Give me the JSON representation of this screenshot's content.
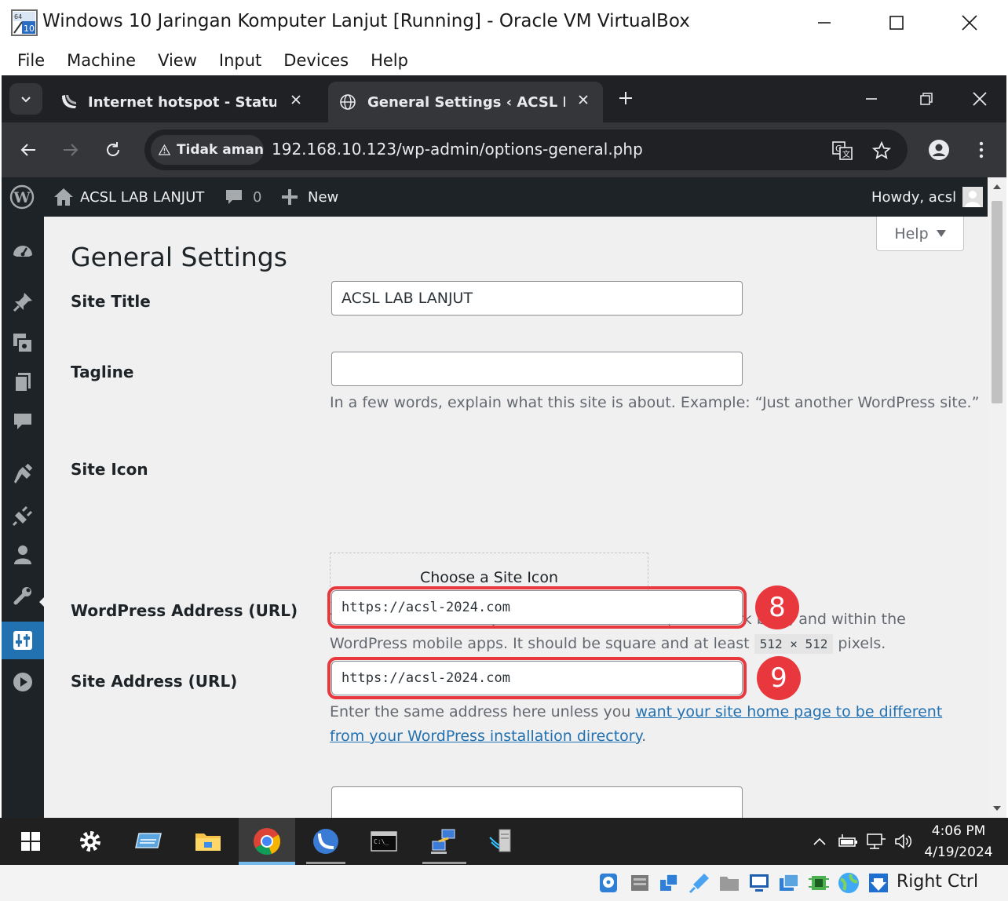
{
  "vbox": {
    "title": "Windows 10 Jaringan Komputer Lanjut [Running] - Oracle VM VirtualBox",
    "menu": [
      "File",
      "Machine",
      "View",
      "Input",
      "Devices",
      "Help"
    ],
    "host_key": "Right Ctrl"
  },
  "browser": {
    "tabs": [
      {
        "label": "Internet hotspot - Status",
        "active": false
      },
      {
        "label": "General Settings ‹ ACSL LAB LANJUT",
        "active": true
      }
    ],
    "security_chip": "Tidak aman",
    "url": "192.168.10.123/wp-admin/options-general.php"
  },
  "adminbar": {
    "site_name": "ACSL LAB LANJUT",
    "comments_count": "0",
    "new_label": "New",
    "howdy": "Howdy, acsl"
  },
  "page": {
    "help_label": "Help",
    "title": "General Settings",
    "site_title_label": "Site Title",
    "site_title_value": "ACSL LAB LANJUT",
    "tagline_label": "Tagline",
    "tagline_value": "",
    "tagline_desc": "In a few words, explain what this site is about. Example: “Just another WordPress site.”",
    "site_icon_label": "Site Icon",
    "site_icon_button": "Choose a Site Icon",
    "site_icon_desc_1": "The Site Icon is what you see in browser tabs, bookmark bars, and within the",
    "site_icon_desc_2a": "WordPress mobile apps. It should be square and at least",
    "site_icon_size": "512 × 512",
    "site_icon_desc_2b": "pixels.",
    "wp_address_label": "WordPress Address (URL)",
    "wp_address_value": "https://acsl-2024.com",
    "site_address_label": "Site Address (URL)",
    "site_address_value": "https://acsl-2024.com",
    "site_address_desc_a": "Enter the same address here unless you",
    "site_address_link_1": "want your site home page to be different",
    "site_address_link_2": "from your WordPress installation directory",
    "site_address_desc_end": "."
  },
  "annotations": {
    "badge_8": "8",
    "badge_9": "9"
  },
  "taskbar": {
    "time": "4:06 PM",
    "date": "4/19/2024"
  },
  "colors": {
    "wp_dark": "#1d2327",
    "wp_blue": "#2271b1",
    "highlight_red": "#e8383d",
    "chrome_dark": "#202124"
  }
}
